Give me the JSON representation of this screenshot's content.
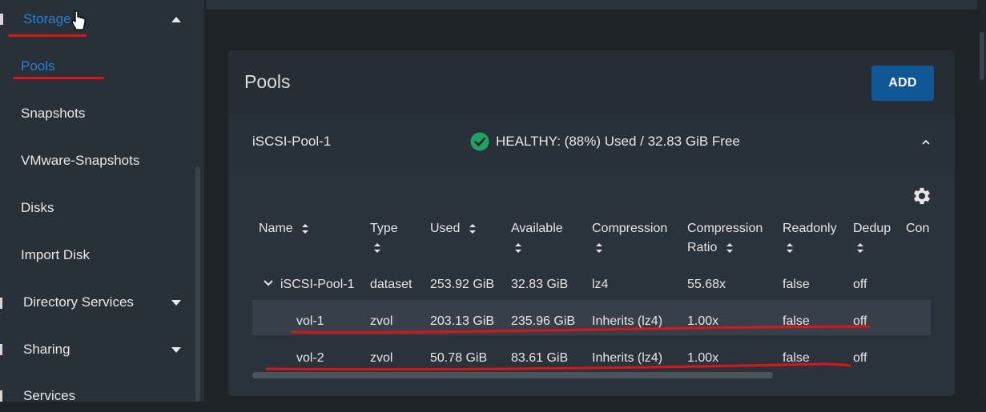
{
  "sidebar": {
    "items": [
      {
        "label": "Storage",
        "caret": "up"
      },
      {
        "label": "Pools"
      },
      {
        "label": "Snapshots"
      },
      {
        "label": "VMware-Snapshots"
      },
      {
        "label": "Disks"
      },
      {
        "label": "Import Disk"
      },
      {
        "label": "Directory Services",
        "caret": "down"
      },
      {
        "label": "Sharing",
        "caret": "down"
      },
      {
        "label": "Services"
      }
    ]
  },
  "card": {
    "title": "Pools",
    "add_label": "ADD"
  },
  "pool": {
    "name": "iSCSI-Pool-1",
    "status": "HEALTHY: (88%) Used / 32.83 GiB Free",
    "status_color": "#1ea362"
  },
  "table": {
    "headers": [
      "Name",
      "Type",
      "Used",
      "Available",
      "Compression",
      "Compression",
      "Ratio",
      "Readonly",
      "Dedup",
      "Con"
    ],
    "rows": [
      {
        "name": "iSCSI-Pool-1",
        "type": "dataset",
        "used": "253.92 GiB",
        "available": "32.83 GiB",
        "compression": "lz4",
        "ratio": "55.68x",
        "readonly": "false",
        "dedup": "off"
      },
      {
        "name": "vol-1",
        "type": "zvol",
        "used": "203.13 GiB",
        "available": "235.96 GiB",
        "compression": "Inherits (lz4)",
        "ratio": "1.00x",
        "readonly": "false",
        "dedup": "off"
      },
      {
        "name": "vol-2",
        "type": "zvol",
        "used": "50.78 GiB",
        "available": "83.61 GiB",
        "compression": "Inherits (lz4)",
        "ratio": "1.00x",
        "readonly": "false",
        "dedup": "off"
      }
    ]
  },
  "colors": {
    "accent": "#2b7fd0",
    "button": "#0f5796",
    "annotation": "#e11414"
  }
}
